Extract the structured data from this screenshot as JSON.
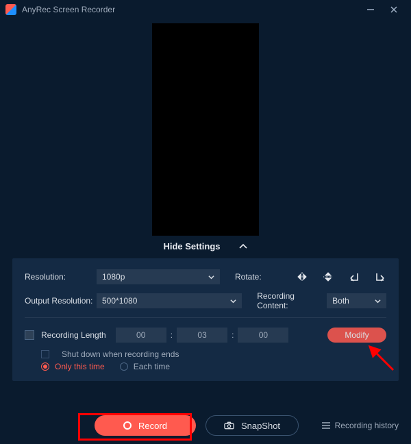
{
  "window": {
    "title": "AnyRec Screen Recorder"
  },
  "toggle": {
    "hide_settings": "Hide Settings"
  },
  "settings": {
    "resolution_label": "Resolution:",
    "resolution_value": "1080p",
    "rotate_label": "Rotate:",
    "output_res_label": "Output Resolution:",
    "output_res_value": "500*1080",
    "rec_content_label": "Recording Content:",
    "rec_content_value": "Both",
    "rec_length_label": "Recording Length",
    "time_h": "00",
    "time_m": "03",
    "time_s": "00",
    "modify": "Modify",
    "shutdown_label": "Shut down when recording ends",
    "only_this_time": "Only this time",
    "each_time": "Each time"
  },
  "footer": {
    "record": "Record",
    "snapshot": "SnapShot",
    "history": "Recording history"
  }
}
